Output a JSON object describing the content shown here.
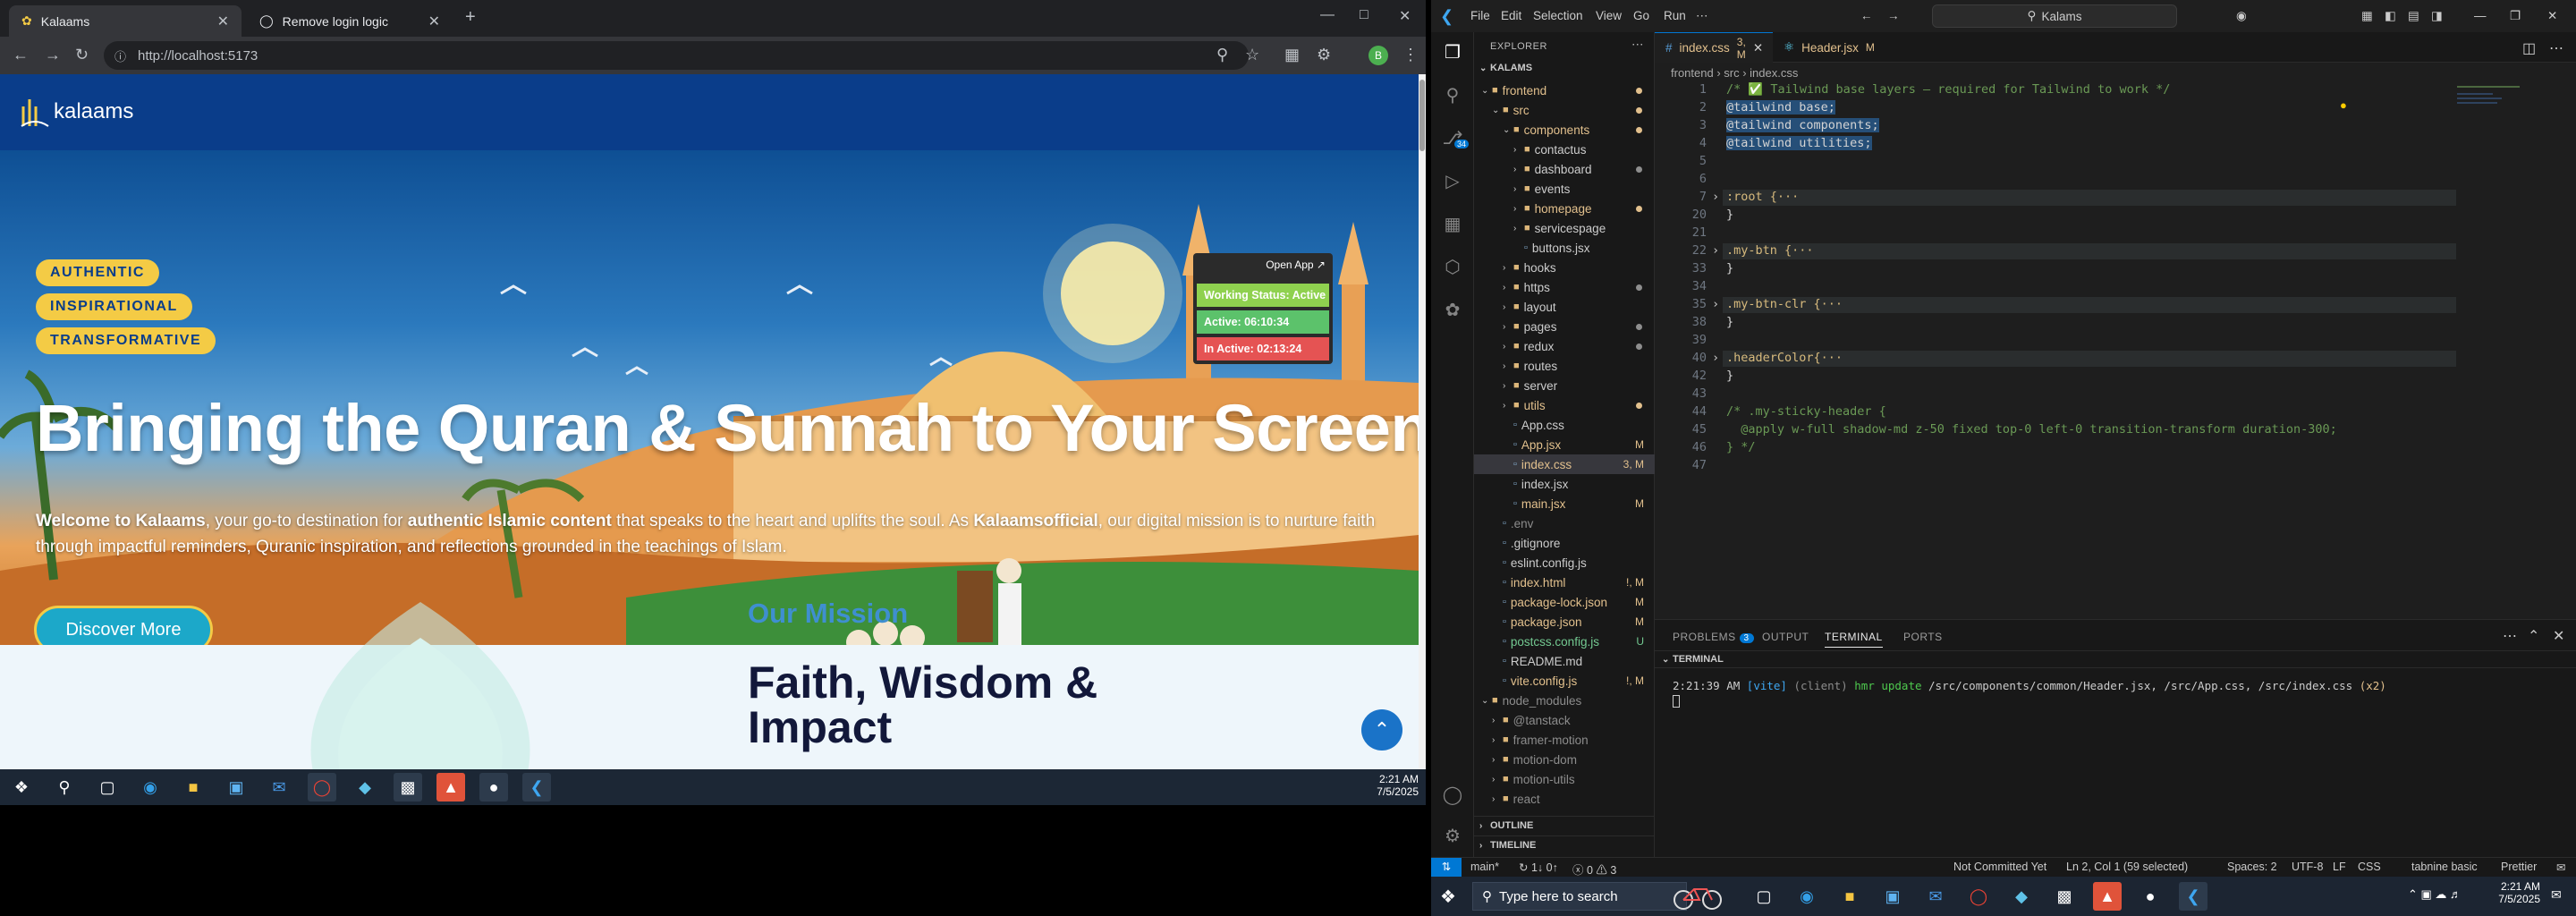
{
  "browser": {
    "tabs": [
      {
        "title": "Kalaams",
        "active": true
      },
      {
        "title": "Remove login logic",
        "active": false
      }
    ],
    "new_tab_symbol": "+",
    "address": "http://localhost:5173"
  },
  "site": {
    "logo_text": "kalaams",
    "pills": [
      "AUTHENTIC",
      "INSPIRATIONAL",
      "TRANSFORMATIVE"
    ],
    "hero_title": "Bringing the Quran & Sunnah to Your Screen",
    "hero_desc": {
      "strong1": "Welcome to Kalaams",
      "t1": ", your go-to destination for ",
      "strong2": "authentic Islamic content",
      "t2": " that speaks to the heart and uplifts the soul. As ",
      "strong3": "Kalaamsofficial",
      "t3": ", our digital mission is to nurture faith through impactful reminders, Quranic inspiration, and reflections grounded in the teachings of Islam."
    },
    "discover_label": "Discover More",
    "mission_label": "Our Mission",
    "mission_heading_1": "Faith, Wisdom &",
    "mission_heading_2": "Impact"
  },
  "work_widget": {
    "open_app": "Open App ↗",
    "status": "Working Status: Active",
    "active": "Active: 06:10:34",
    "inactive": "In Active: 02:13:24",
    "colors": {
      "status": "#8fd14f",
      "active": "#5cc26b",
      "inactive": "#e55353"
    }
  },
  "left_taskbar": {
    "time": "2:21 AM",
    "date": "7/5/2025"
  },
  "vscode": {
    "menu": [
      "File",
      "Edit",
      "Selection",
      "View",
      "Go",
      "Run"
    ],
    "search": "Kalams",
    "explorer_title": "EXPLORER",
    "workspace": "KALAMS",
    "tree": [
      {
        "name": "frontend",
        "type": "folder",
        "open": true,
        "depth": 0,
        "dot": true,
        "color": "#e2c08d"
      },
      {
        "name": "src",
        "type": "folder",
        "open": true,
        "depth": 1,
        "dot": true,
        "color": "#e2c08d"
      },
      {
        "name": "components",
        "type": "folder",
        "open": true,
        "depth": 2,
        "dot": true,
        "color": "#e2c08d"
      },
      {
        "name": "contactus",
        "type": "folder",
        "depth": 3
      },
      {
        "name": "dashboard",
        "type": "folder",
        "depth": 3,
        "dot": true
      },
      {
        "name": "events",
        "type": "folder",
        "depth": 3
      },
      {
        "name": "homepage",
        "type": "folder",
        "depth": 3,
        "dot": true,
        "color": "#e2c08d"
      },
      {
        "name": "servicespage",
        "type": "folder",
        "depth": 3
      },
      {
        "name": "buttons.jsx",
        "type": "file",
        "depth": 3
      },
      {
        "name": "hooks",
        "type": "folder",
        "depth": 2
      },
      {
        "name": "https",
        "type": "folder",
        "depth": 2,
        "dot": true
      },
      {
        "name": "layout",
        "type": "folder",
        "depth": 2
      },
      {
        "name": "pages",
        "type": "folder",
        "depth": 2,
        "dot": true
      },
      {
        "name": "redux",
        "type": "folder",
        "depth": 2,
        "dot": true
      },
      {
        "name": "routes",
        "type": "folder",
        "depth": 2
      },
      {
        "name": "server",
        "type": "folder",
        "depth": 2
      },
      {
        "name": "utils",
        "type": "folder",
        "depth": 2,
        "dot": true,
        "color": "#e2c08d"
      },
      {
        "name": "App.css",
        "type": "file",
        "depth": 2
      },
      {
        "name": "App.jsx",
        "type": "file",
        "depth": 2,
        "status": "M",
        "color": "#e2c08d"
      },
      {
        "name": "index.css",
        "type": "file",
        "depth": 2,
        "status": "3, M",
        "color": "#e2c08d",
        "selected": true
      },
      {
        "name": "index.jsx",
        "type": "file",
        "depth": 2
      },
      {
        "name": "main.jsx",
        "type": "file",
        "depth": 2,
        "status": "M",
        "color": "#e2c08d"
      },
      {
        "name": ".env",
        "type": "file",
        "depth": 1,
        "color": "#8c8c8c"
      },
      {
        "name": ".gitignore",
        "type": "file",
        "depth": 1
      },
      {
        "name": "eslint.config.js",
        "type": "file",
        "depth": 1
      },
      {
        "name": "index.html",
        "type": "file",
        "depth": 1,
        "status": "!, M",
        "color": "#e2c08d"
      },
      {
        "name": "package-lock.json",
        "type": "file",
        "depth": 1,
        "status": "M",
        "color": "#e2c08d"
      },
      {
        "name": "package.json",
        "type": "file",
        "depth": 1,
        "status": "M",
        "color": "#e2c08d"
      },
      {
        "name": "postcss.config.js",
        "type": "file",
        "depth": 1,
        "status": "U",
        "color": "#73c991"
      },
      {
        "name": "README.md",
        "type": "file",
        "depth": 1
      },
      {
        "name": "vite.config.js",
        "type": "file",
        "depth": 1,
        "status": "!, M",
        "color": "#e2c08d"
      },
      {
        "name": "node_modules",
        "type": "folder",
        "open": true,
        "depth": 0,
        "color": "#8c8c8c"
      },
      {
        "name": "@tanstack",
        "type": "folder",
        "depth": 1,
        "color": "#8c8c8c"
      },
      {
        "name": "framer-motion",
        "type": "folder",
        "depth": 1,
        "color": "#8c8c8c"
      },
      {
        "name": "motion-dom",
        "type": "folder",
        "depth": 1,
        "color": "#8c8c8c"
      },
      {
        "name": "motion-utils",
        "type": "folder",
        "depth": 1,
        "color": "#8c8c8c"
      },
      {
        "name": "react",
        "type": "folder",
        "depth": 1,
        "color": "#8c8c8c"
      }
    ],
    "outline": "OUTLINE",
    "timeline": "TIMELINE",
    "editor_tabs": [
      {
        "title": "index.css",
        "badge": "3, M",
        "active": true,
        "color": "#e2c08d"
      },
      {
        "title": "Header.jsx",
        "badge": "M",
        "active": false,
        "color": "#e2c08d"
      }
    ],
    "breadcrumb": "frontend  ›  src  ›  index.css",
    "code_lines": [
      {
        "n": "1",
        "t": "/* ✅ Tailwind base layers — required for Tailwind to work */",
        "c": "#6a9955"
      },
      {
        "n": "2",
        "t": "@tailwind base;",
        "c": "#d4d4d4",
        "sel": true
      },
      {
        "n": "3",
        "t": "@tailwind components;",
        "c": "#d4d4d4",
        "sel": true
      },
      {
        "n": "4",
        "t": "@tailwind utilities;",
        "c": "#d4d4d4",
        "sel": true
      },
      {
        "n": "5",
        "t": "",
        "c": "#d4d4d4"
      },
      {
        "n": "6",
        "t": "",
        "c": "#d4d4d4"
      },
      {
        "n": "7",
        "t": ":root {···",
        "c": "#d7ba7d",
        "fold": true
      },
      {
        "n": "20",
        "t": "}",
        "c": "#d4d4d4"
      },
      {
        "n": "21",
        "t": "",
        "c": "#d4d4d4"
      },
      {
        "n": "22",
        "t": ".my-btn {···",
        "c": "#d7ba7d",
        "fold": true
      },
      {
        "n": "33",
        "t": "}",
        "c": "#d4d4d4"
      },
      {
        "n": "34",
        "t": "",
        "c": "#d4d4d4"
      },
      {
        "n": "35",
        "t": ".my-btn-clr {···",
        "c": "#d7ba7d",
        "fold": true
      },
      {
        "n": "38",
        "t": "}",
        "c": "#d4d4d4"
      },
      {
        "n": "39",
        "t": "",
        "c": "#d4d4d4"
      },
      {
        "n": "40",
        "t": ".headerColor{···",
        "c": "#d7ba7d",
        "fold": true
      },
      {
        "n": "42",
        "t": "}",
        "c": "#d4d4d4"
      },
      {
        "n": "43",
        "t": "",
        "c": "#d4d4d4"
      },
      {
        "n": "44",
        "t": "/* .my-sticky-header {",
        "c": "#6a9955"
      },
      {
        "n": "45",
        "t": "  @apply w-full shadow-md z-50 fixed top-0 left-0 transition-transform duration-300;",
        "c": "#6a9955"
      },
      {
        "n": "46",
        "t": "} */",
        "c": "#6a9955"
      },
      {
        "n": "47",
        "t": "",
        "c": "#d4d4d4"
      }
    ],
    "panel_tabs": [
      "PROBLEMS",
      "OUTPUT",
      "TERMINAL",
      "PORTS"
    ],
    "problems_count": "3",
    "terminal_header": "TERMINAL",
    "terminal_line": {
      "time": "2:21:39 AM",
      "tag": "[vite]",
      "client": "(client)",
      "msg": "hmr update",
      "files": "/src/components/common/Header.jsx, /src/App.css, /src/index.css",
      "count": "(x2)"
    },
    "status_bar": {
      "branch": "main*",
      "sync": "↻ 1↓ 0↑",
      "errors": "ⓧ 0 ⚠ 3",
      "commit": "Not Committed Yet",
      "position": "Ln 2, Col 1 (59 selected)",
      "spaces": "Spaces: 2",
      "encoding": "UTF-8",
      "eol": "LF",
      "lang": "CSS",
      "tabnine": "tabnine basic",
      "prettier": "Prettier"
    },
    "scm_badge": "34"
  },
  "right_taskbar": {
    "search_placeholder": "Type here to search",
    "time": "2:21 AM",
    "date": "7/5/2025"
  }
}
